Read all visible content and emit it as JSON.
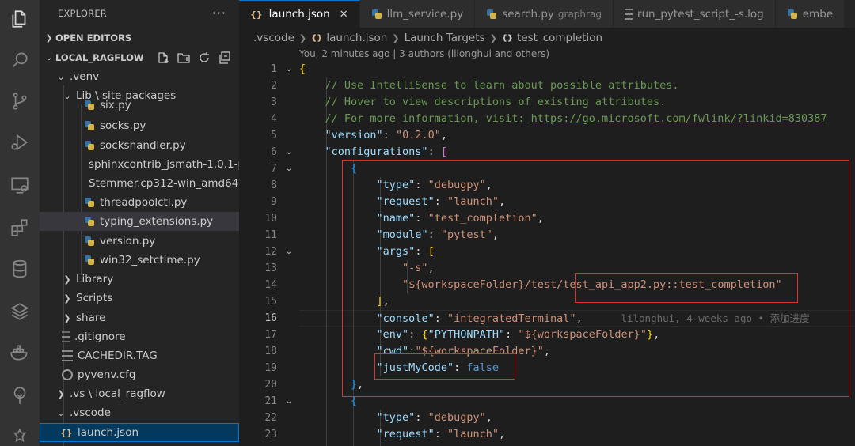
{
  "activity_bar": {
    "icons": [
      "explorer-icon",
      "search-icon",
      "source-control-icon",
      "run-debug-icon",
      "remote-explorer-icon",
      "extensions-icon",
      "database-icon",
      "layers-icon",
      "docker-icon",
      "tree-icon",
      "settings-icon"
    ]
  },
  "sidebar": {
    "title": "EXPLORER",
    "more": "···",
    "open_editors": "OPEN EDITORS",
    "workspace": "LOCAL_RAGFLOW",
    "tree": [
      {
        "label": ".venv"
      },
      {
        "label": "Lib \\ site-packages"
      },
      {
        "label": "six.py"
      },
      {
        "label": "socks.py"
      },
      {
        "label": "sockshandler.py"
      },
      {
        "label": "sphinxcontrib_jsmath-1.0.1-p..."
      },
      {
        "label": "Stemmer.cp312-win_amd64...."
      },
      {
        "label": "threadpoolctl.py"
      },
      {
        "label": "typing_extensions.py"
      },
      {
        "label": "version.py"
      },
      {
        "label": "win32_setctime.py"
      },
      {
        "label": "Library"
      },
      {
        "label": "Scripts"
      },
      {
        "label": "share"
      },
      {
        "label": ".gitignore"
      },
      {
        "label": "CACHEDIR.TAG"
      },
      {
        "label": "pyvenv.cfg"
      },
      {
        "label": ".vs \\ local_ragflow"
      },
      {
        "label": ".vscode"
      },
      {
        "label": "launch.json"
      }
    ]
  },
  "tabs": [
    {
      "icon": "{}",
      "label": "launch.json",
      "desc": "",
      "close": "✕"
    },
    {
      "label": "llm_service.py",
      "desc": ""
    },
    {
      "label": "search.py",
      "desc": "graphrag"
    },
    {
      "label": "run_pytest_script_-s.log",
      "desc": ""
    },
    {
      "label": "embe",
      "desc": ""
    }
  ],
  "breadcrumb": {
    "items": [
      ".vscode",
      "launch.json",
      "Launch Targets",
      "test_completion"
    ],
    "icon_json": "{}",
    "icon_obj": "{}"
  },
  "blame_header": "You, 2 minutes ago | 3 authors (lilonghui and others)",
  "editor": {
    "line_numbers": [
      "1",
      "2",
      "3",
      "4",
      "5",
      "6",
      "7",
      "8",
      "9",
      "10",
      "11",
      "12",
      "13",
      "14",
      "15",
      "16",
      "17",
      "18",
      "19",
      "20",
      "21",
      "22",
      "23"
    ],
    "comments": [
      "// Use IntelliSense to learn about possible attributes.",
      "// Hover to view descriptions of existing attributes.",
      "// For more information, visit: "
    ],
    "link": "https://go.microsoft.com/fwlink/?linkid=830387",
    "keys": {
      "version": "\"version\"",
      "configurations": "\"configurations\"",
      "type": "\"type\"",
      "request": "\"request\"",
      "name": "\"name\"",
      "module": "\"module\"",
      "args": "\"args\"",
      "console": "\"console\"",
      "env": "\"env\"",
      "pythonpath": "\"PYTHONPATH\"",
      "cwd": "\"cwd\"",
      "justmycode": "\"justMyCode\""
    },
    "values": {
      "version": "\"0.2.0\"",
      "debugpy": "\"debugpy\"",
      "launch": "\"launch\"",
      "test_completion": "\"test_completion\"",
      "pytest": "\"pytest\"",
      "arg_s": "\"-s\"",
      "arg_path_a": "\"${workspaceFolder}/test/",
      "arg_path_b": "test_api_app2.py::test_completion",
      "arg_path_c": "\"",
      "integrated": "\"integratedTerminal\"",
      "workspace_env": "\"${workspaceFolder}\"",
      "workspace_cwd": "\"${workspaceFolder}\"",
      "false": "false"
    },
    "blame_line16": "lilonghui, 4 weeks ago • 添加进度"
  }
}
